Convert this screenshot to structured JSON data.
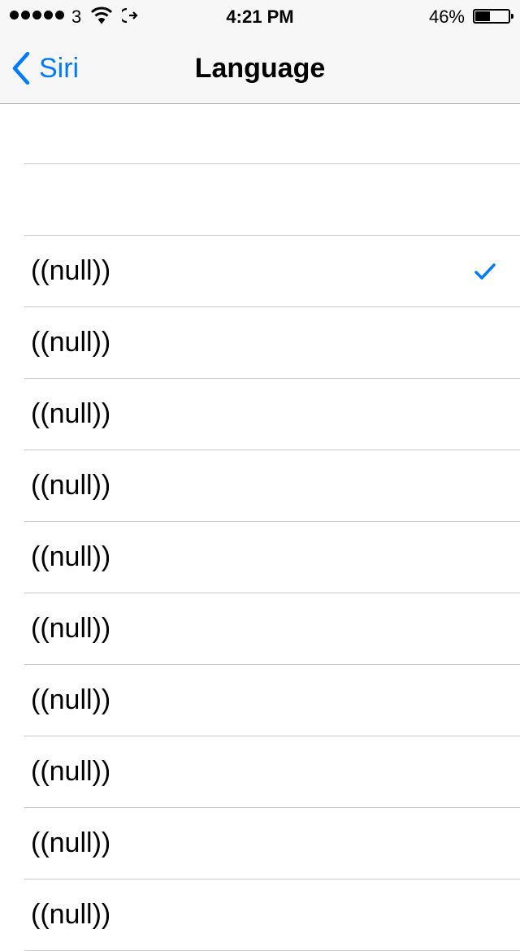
{
  "status_bar": {
    "carrier": "3",
    "time": "4:21 PM",
    "battery_percent": "46%",
    "battery_level": 0.46,
    "signal_bars": 5,
    "icons": [
      "signal-dots-icon",
      "wifi-icon",
      "call-forwarding-icon",
      "battery-icon"
    ]
  },
  "nav": {
    "back_label": "Siri",
    "title": "Language"
  },
  "colors": {
    "accent": "#007aff",
    "bar_bg": "#f7f7f7",
    "separator": "#c8c7cc"
  },
  "languages": [
    {
      "label": "((null))",
      "selected": true
    },
    {
      "label": "((null))",
      "selected": false
    },
    {
      "label": "((null))",
      "selected": false
    },
    {
      "label": "((null))",
      "selected": false
    },
    {
      "label": "((null))",
      "selected": false
    },
    {
      "label": "((null))",
      "selected": false
    },
    {
      "label": "((null))",
      "selected": false
    },
    {
      "label": "((null))",
      "selected": false
    },
    {
      "label": "((null))",
      "selected": false
    },
    {
      "label": "((null))",
      "selected": false
    }
  ]
}
